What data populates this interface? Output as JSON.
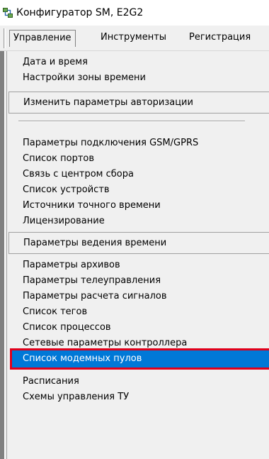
{
  "window": {
    "title": "Конфигуратор SM, E2G2",
    "icon": "app-network-icon"
  },
  "menubar": {
    "items": [
      {
        "label": "Управление",
        "active": true
      },
      {
        "label": "Инструменты",
        "active": false
      },
      {
        "label": "Регистрация",
        "active": false
      }
    ]
  },
  "dropdown": {
    "items": [
      {
        "label": "Дата и время"
      },
      {
        "label": "Настройки зоны времени"
      },
      {
        "label": "Изменить параметры  авторизации"
      },
      {
        "label": "Параметры подключения GSM/GPRS"
      },
      {
        "label": "Список портов"
      },
      {
        "label": "Связь с центром сбора"
      },
      {
        "label": "Список устройств"
      },
      {
        "label": "Источники точного времени"
      },
      {
        "label": "Лицензирование"
      },
      {
        "label": "Параметры ведения времени"
      },
      {
        "label": "Параметры архивов"
      },
      {
        "label": "Параметры телеуправления"
      },
      {
        "label": "Параметры расчета сигналов"
      },
      {
        "label": "Список тегов"
      },
      {
        "label": "Список процессов"
      },
      {
        "label": "Сетевые параметры контроллера"
      },
      {
        "label": "Список модемных пулов"
      },
      {
        "label": "Расписания"
      },
      {
        "label": "Схемы управления ТУ"
      }
    ],
    "selected_index": 16
  },
  "colors": {
    "highlight": "#0078d7",
    "annotation_box": "#e0001b",
    "menu_bg": "#f0f0f0"
  }
}
